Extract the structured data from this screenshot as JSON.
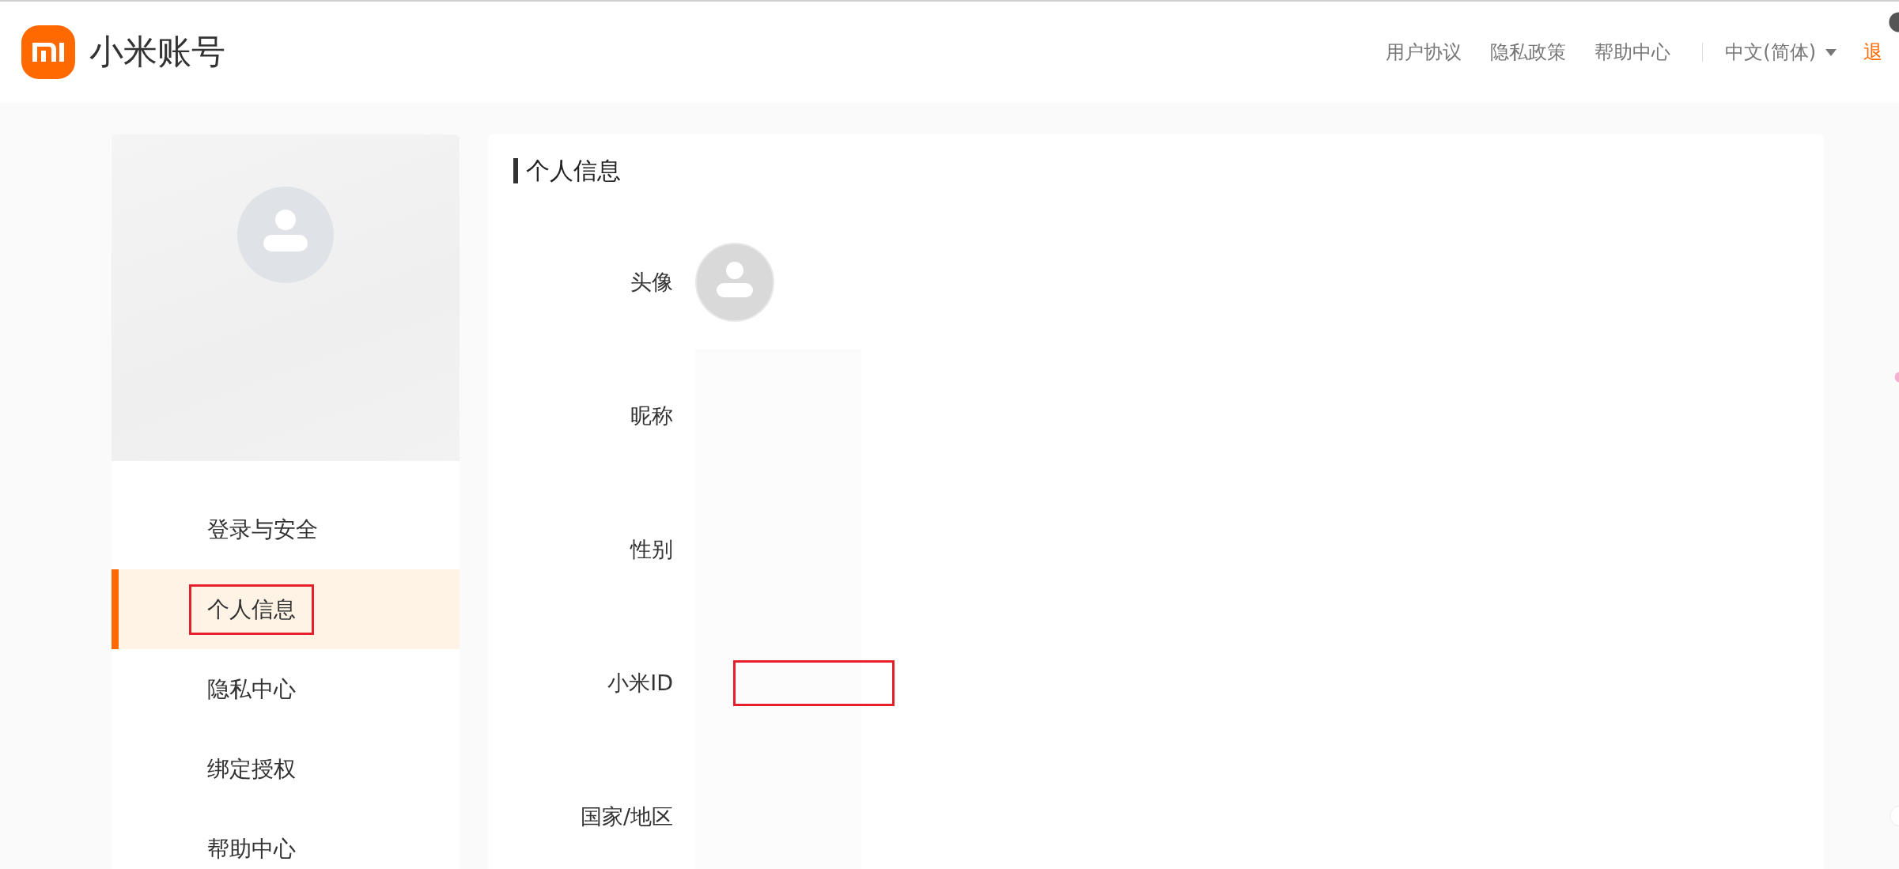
{
  "header": {
    "title": "小米账号",
    "links": [
      "用户协议",
      "隐私政策",
      "帮助中心"
    ],
    "language": "中文(简体)",
    "logout": "退"
  },
  "sidebar": {
    "items": [
      {
        "label": "登录与安全",
        "selected": false,
        "highlighted": false
      },
      {
        "label": "个人信息",
        "selected": true,
        "highlighted": true
      },
      {
        "label": "隐私中心",
        "selected": false,
        "highlighted": false
      },
      {
        "label": "绑定授权",
        "selected": false,
        "highlighted": false
      },
      {
        "label": "帮助中心",
        "selected": false,
        "highlighted": false
      }
    ]
  },
  "profile": {
    "title": "个人信息",
    "fields": [
      {
        "label": "头像",
        "kind": "avatar",
        "highlighted": false
      },
      {
        "label": "昵称",
        "kind": "text",
        "highlighted": false
      },
      {
        "label": "性别",
        "kind": "text",
        "highlighted": false
      },
      {
        "label": "小米ID",
        "kind": "text",
        "highlighted": true
      },
      {
        "label": "国家/地区",
        "kind": "text",
        "highlighted": false
      }
    ]
  }
}
